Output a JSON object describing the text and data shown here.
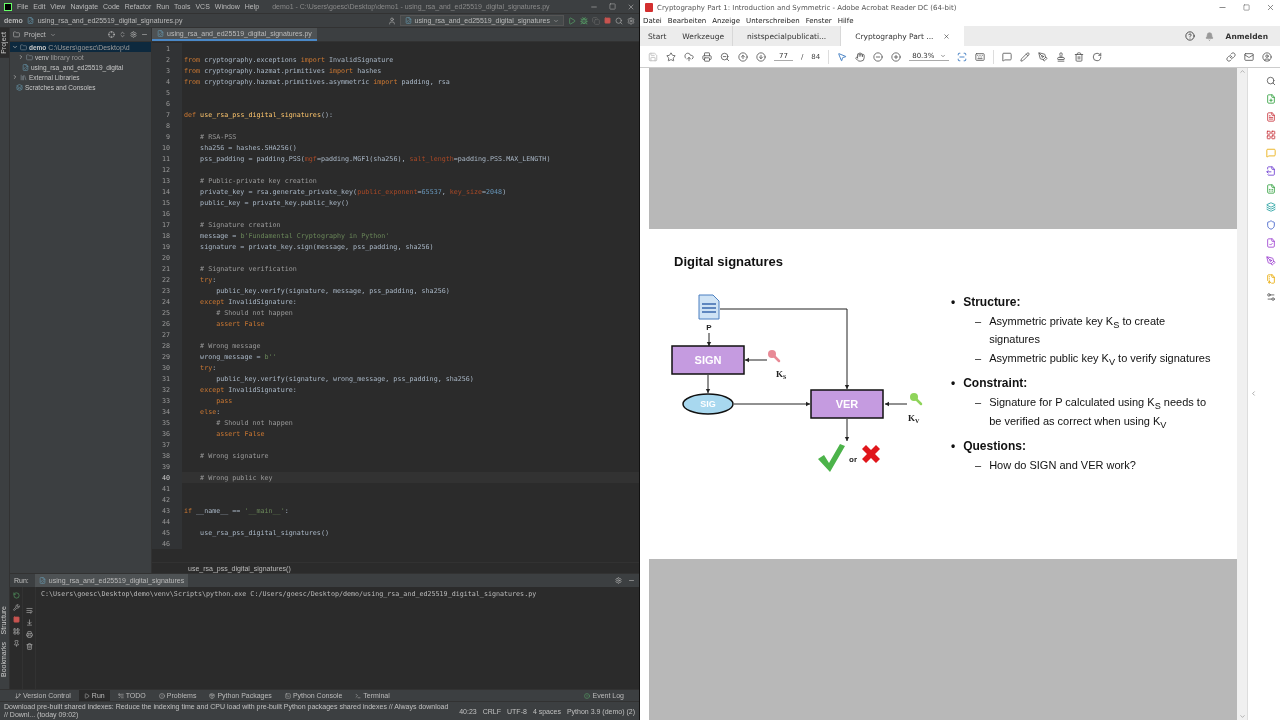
{
  "ide": {
    "menu": [
      "File",
      "Edit",
      "View",
      "Navigate",
      "Code",
      "Refactor",
      "Run",
      "Tools",
      "VCS",
      "Window",
      "Help"
    ],
    "title": "demo1 - C:\\Users\\goesc\\Desktop\\demo1 - using_rsa_and_ed25519_digital_signatures.py",
    "breadcrumbs": [
      "demo",
      "using_rsa_and_ed25519_digital_signatures.py"
    ],
    "run_config": "using_rsa_and_ed25519_digital_signatures",
    "side_tabs": [
      {
        "label": "Project",
        "selected": true
      },
      {
        "label": "Structure",
        "selected": false
      },
      {
        "label": "Bookmarks",
        "selected": false
      }
    ],
    "project": {
      "title": "Project",
      "tree": [
        {
          "name": "demo",
          "path": "C:\\Users\\goesc\\Desktop\\d",
          "kind": "folder",
          "expanded": true,
          "selected": true,
          "children": [
            {
              "name": "venv",
              "path": "library root",
              "kind": "folder",
              "expanded": false,
              "selected": false
            },
            {
              "name": "using_rsa_and_ed25519_digital",
              "kind": "file",
              "selected": false
            }
          ]
        },
        {
          "name": "External Libraries",
          "kind": "library",
          "expanded": false,
          "selected": false
        },
        {
          "name": "Scratches and Consoles",
          "kind": "scratch",
          "selected": false
        }
      ]
    },
    "editor": {
      "tab": "using_rsa_and_ed25519_digital_signatures.py",
      "lines": [
        {
          "number": "1",
          "current": false
        },
        {
          "number": "2",
          "current": false,
          "tokens": [
            {
              "kind": "kw",
              "text": "from"
            },
            {
              "kind": "plain",
              "text": " cryptography.exceptions "
            },
            {
              "kind": "kw",
              "text": "import"
            },
            {
              "kind": "plain",
              "text": " InvalidSignature"
            }
          ]
        },
        {
          "number": "3",
          "current": false,
          "tokens": [
            {
              "kind": "kw",
              "text": "from"
            },
            {
              "kind": "plain",
              "text": " cryptography.hazmat.primitives "
            },
            {
              "kind": "kw",
              "text": "import"
            },
            {
              "kind": "plain",
              "text": " hashes"
            }
          ]
        },
        {
          "number": "4",
          "current": false,
          "tokens": [
            {
              "kind": "kw",
              "text": "from"
            },
            {
              "kind": "plain",
              "text": " cryptography.hazmat.primitives.asymmetric "
            },
            {
              "kind": "kw",
              "text": "import"
            },
            {
              "kind": "plain",
              "text": " padding, rsa"
            }
          ]
        },
        {
          "number": "5",
          "current": false
        },
        {
          "number": "6",
          "current": false
        },
        {
          "number": "7",
          "current": false,
          "tokens": [
            {
              "kind": "kw",
              "text": "def"
            },
            {
              "kind": "fn",
              "text": " use_rsa_pss_digital_signatures"
            },
            {
              "kind": "plain",
              "text": "():"
            }
          ]
        },
        {
          "number": "8",
          "current": false
        },
        {
          "number": "9",
          "current": false,
          "tokens": [
            {
              "kind": "comment",
              "text": "    # RSA-PSS"
            }
          ]
        },
        {
          "number": "10",
          "current": false,
          "tokens": [
            {
              "kind": "plain",
              "text": "    sha256 = hashes.SHA256()"
            }
          ]
        },
        {
          "number": "11",
          "current": false,
          "tokens": [
            {
              "kind": "plain",
              "text": "    pss_padding = padding.PSS("
            },
            {
              "kind": "param",
              "text": "mgf"
            },
            {
              "kind": "plain",
              "text": "=padding.MGF1(sha256), "
            },
            {
              "kind": "param",
              "text": "salt_length"
            },
            {
              "kind": "plain",
              "text": "=padding.PSS.MAX_LENGTH)"
            }
          ]
        },
        {
          "number": "12",
          "current": false
        },
        {
          "number": "13",
          "current": false,
          "tokens": [
            {
              "kind": "comment",
              "text": "    # Public-private key creation"
            }
          ]
        },
        {
          "number": "14",
          "current": false,
          "tokens": [
            {
              "kind": "plain",
              "text": "    private_key = rsa.generate_private_key("
            },
            {
              "kind": "param",
              "text": "public_exponent"
            },
            {
              "kind": "plain",
              "text": "="
            },
            {
              "kind": "num",
              "text": "65537"
            },
            {
              "kind": "plain",
              "text": ", "
            },
            {
              "kind": "param",
              "text": "key_size"
            },
            {
              "kind": "plain",
              "text": "="
            },
            {
              "kind": "num",
              "text": "2048"
            },
            {
              "kind": "plain",
              "text": ")"
            }
          ]
        },
        {
          "number": "15",
          "current": false,
          "tokens": [
            {
              "kind": "plain",
              "text": "    public_key = private_key.public_key()"
            }
          ]
        },
        {
          "number": "16",
          "current": false
        },
        {
          "number": "17",
          "current": false,
          "tokens": [
            {
              "kind": "comment",
              "text": "    # Signature creation"
            }
          ]
        },
        {
          "number": "18",
          "current": false,
          "tokens": [
            {
              "kind": "plain",
              "text": "    message = "
            },
            {
              "kind": "str",
              "text": "b'Fundamental Cryptography in Python'"
            }
          ]
        },
        {
          "number": "19",
          "current": false,
          "tokens": [
            {
              "kind": "plain",
              "text": "    signature = private_key.sign(message, pss_padding, sha256)"
            }
          ]
        },
        {
          "number": "20",
          "current": false
        },
        {
          "number": "21",
          "current": false,
          "tokens": [
            {
              "kind": "comment",
              "text": "    # Signature verification"
            }
          ]
        },
        {
          "number": "22",
          "current": false,
          "tokens": [
            {
              "kind": "kw",
              "text": "    try"
            },
            {
              "kind": "plain",
              "text": ":"
            }
          ]
        },
        {
          "number": "23",
          "current": false,
          "tokens": [
            {
              "kind": "plain",
              "text": "        public_key.verify(signature, message, pss_padding, sha256)"
            }
          ]
        },
        {
          "number": "24",
          "current": false,
          "tokens": [
            {
              "kind": "kw",
              "text": "    except"
            },
            {
              "kind": "plain",
              "text": " InvalidSignature:"
            }
          ]
        },
        {
          "number": "25",
          "current": false,
          "tokens": [
            {
              "kind": "comment",
              "text": "        # Should not happen"
            }
          ]
        },
        {
          "number": "26",
          "current": false,
          "tokens": [
            {
              "kind": "kw",
              "text": "        assert False"
            }
          ]
        },
        {
          "number": "27",
          "current": false
        },
        {
          "number": "28",
          "current": false,
          "tokens": [
            {
              "kind": "comment",
              "text": "    # Wrong message"
            }
          ]
        },
        {
          "number": "29",
          "current": false,
          "tokens": [
            {
              "kind": "plain",
              "text": "    wrong_message = "
            },
            {
              "kind": "str",
              "text": "b''"
            }
          ]
        },
        {
          "number": "30",
          "current": false,
          "tokens": [
            {
              "kind": "kw",
              "text": "    try"
            },
            {
              "kind": "plain",
              "text": ":"
            }
          ]
        },
        {
          "number": "31",
          "current": false,
          "tokens": [
            {
              "kind": "plain",
              "text": "        public_key.verify(signature, wrong_message, pss_padding, sha256)"
            }
          ]
        },
        {
          "number": "32",
          "current": false,
          "tokens": [
            {
              "kind": "kw",
              "text": "    except"
            },
            {
              "kind": "plain",
              "text": " InvalidSignature:"
            }
          ]
        },
        {
          "number": "33",
          "current": false,
          "tokens": [
            {
              "kind": "kw",
              "text": "        pass"
            }
          ]
        },
        {
          "number": "34",
          "current": false,
          "tokens": [
            {
              "kind": "kw",
              "text": "    else"
            },
            {
              "kind": "plain",
              "text": ":"
            }
          ]
        },
        {
          "number": "35",
          "current": false,
          "tokens": [
            {
              "kind": "comment",
              "text": "        # Should not happen"
            }
          ]
        },
        {
          "number": "36",
          "current": false,
          "tokens": [
            {
              "kind": "kw",
              "text": "        assert False"
            }
          ]
        },
        {
          "number": "37",
          "current": false
        },
        {
          "number": "38",
          "current": false,
          "tokens": [
            {
              "kind": "comment",
              "text": "    # Wrong signature"
            }
          ]
        },
        {
          "number": "39",
          "current": false
        },
        {
          "number": "40",
          "current": true,
          "tokens": [
            {
              "kind": "comment",
              "text": "    # Wrong public key"
            }
          ]
        },
        {
          "number": "41",
          "current": false
        },
        {
          "number": "42",
          "current": false
        },
        {
          "number": "43",
          "current": false,
          "tokens": [
            {
              "kind": "kw",
              "text": "if"
            },
            {
              "kind": "plain",
              "text": " __name__ == "
            },
            {
              "kind": "str",
              "text": "'__main__'"
            },
            {
              "kind": "plain",
              "text": ":"
            }
          ]
        },
        {
          "number": "44",
          "current": false
        },
        {
          "number": "45",
          "current": false,
          "tokens": [
            {
              "kind": "plain",
              "text": "    use_rsa_pss_digital_signatures()"
            }
          ]
        },
        {
          "number": "46",
          "current": false
        }
      ]
    },
    "function_crumb": "use_rsa_pss_digital_signatures()",
    "run": {
      "label": "Run:",
      "tab": "using_rsa_and_ed25519_digital_signatures",
      "output": "C:\\Users\\goesc\\Desktop\\demo\\venv\\Scripts\\python.exe C:/Users/goesc/Desktop/demo/using_rsa_and_ed25519_digital_signatures.py"
    },
    "tool_tabs": [
      {
        "label": "Version Control",
        "kind": "vcs",
        "selected": false
      },
      {
        "label": "Run",
        "kind": "run",
        "selected": true
      },
      {
        "label": "TODO",
        "kind": "todo",
        "selected": false
      },
      {
        "label": "Problems",
        "kind": "problems",
        "selected": false
      },
      {
        "label": "Python Packages",
        "kind": "packages",
        "selected": false
      },
      {
        "label": "Python Console",
        "kind": "console",
        "selected": false
      },
      {
        "label": "Terminal",
        "kind": "terminal",
        "selected": false
      }
    ],
    "event_log": "Event Log",
    "status": {
      "message": "Download pre-built shared indexes: Reduce the indexing time and CPU load with pre-built Python packages shared indexes // Always download // Downl... (today 09:02)",
      "items": [
        "40:23",
        "CRLF",
        "UTF-8",
        "4 spaces",
        "Python 3.9 (demo) (2)"
      ]
    }
  },
  "reader": {
    "title": "Cryptography Part 1: Introduction and Symmetric - Adobe Acrobat Reader DC (64-bit)",
    "menu": [
      "Datei",
      "Bearbeiten",
      "Anzeige",
      "Unterschreiben",
      "Fenster",
      "Hilfe"
    ],
    "tabs": [
      {
        "label": "Start",
        "kind": "view",
        "selected": false
      },
      {
        "label": "Werkzeuge",
        "kind": "view",
        "selected": false
      },
      {
        "label": "nistspecialpublicati...",
        "kind": "document",
        "selected": false
      },
      {
        "label": "Cryptography Part ...",
        "kind": "document",
        "selected": true
      }
    ],
    "sign_in": "Anmelden",
    "page": "77",
    "page_separator": "/",
    "page_count": "84",
    "zoom": "80.3%",
    "slide": {
      "title": "Digital signatures",
      "diagram": {
        "document_label": "P",
        "sign": "SIGN",
        "sig": "SIG",
        "ver": "VER",
        "signing_key": {
          "base": "K",
          "sub": "S"
        },
        "verifying_key": {
          "base": "K",
          "sub": "V"
        },
        "or": "or"
      },
      "bullets": [
        {
          "bullet": "•",
          "text": "Structure:",
          "children": [
            {
              "bullet": "–",
              "text": "Asymmetric private key K$_{S}$ to create signatures"
            },
            {
              "bullet": "–",
              "text": "Asymmetric public key K$_{V}$ to verify signatures"
            }
          ]
        },
        {
          "bullet": "•",
          "text": "Constraint:",
          "children": [
            {
              "bullet": "–",
              "text": "Signature for P calculated using K$_{S}$ needs to be verified as correct when using K$_{V}$"
            }
          ]
        },
        {
          "bullet": "•",
          "text": "Questions:",
          "children": [
            {
              "bullet": "–",
              "text": "How do SIGN and VER work?"
            }
          ]
        }
      ]
    }
  }
}
